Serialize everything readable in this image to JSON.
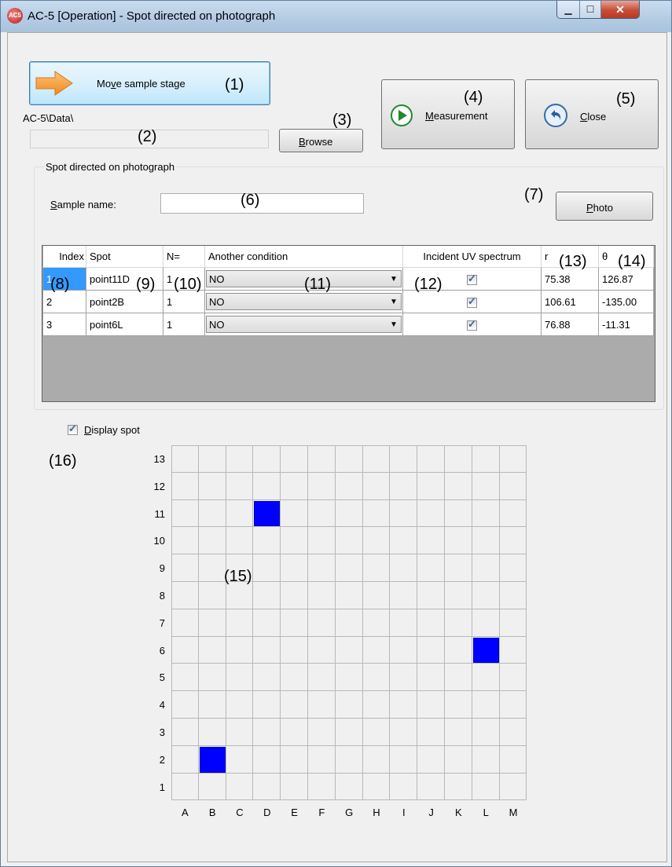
{
  "window": {
    "title": "AC-5 [Operation] - Spot directed on photograph",
    "icon": "ac5-app-icon",
    "icon_text": "AC5",
    "controls": {
      "minimize": "▁",
      "maximize": "☐",
      "close": "✕"
    }
  },
  "toolbar": {
    "move_stage_label_pre": "Mo",
    "move_stage_label_u": "v",
    "move_stage_label_post": "e sample stage",
    "path_label": "AC-5\\Data\\",
    "path_value": "",
    "browse_label_u": "B",
    "browse_label_post": "rowse",
    "measurement_label_u": "M",
    "measurement_label_post": "easurement",
    "close_label_u": "C",
    "close_label_post": "lose"
  },
  "group": {
    "title": "Spot directed on photograph",
    "sample_label_u": "S",
    "sample_label_post": "ample name:",
    "sample_value": "",
    "photo_label_u": "P",
    "photo_label_post": "hoto"
  },
  "table": {
    "columns": [
      "Index",
      "Spot",
      "N=",
      "Another condition",
      "Incident UV spectrum",
      "r",
      "θ"
    ],
    "rows": [
      {
        "index": "1",
        "spot": "point11D",
        "n": "1",
        "condition": "NO",
        "uv": true,
        "r": "75.38",
        "theta": "126.87"
      },
      {
        "index": "2",
        "spot": "point2B",
        "n": "1",
        "condition": "NO",
        "uv": true,
        "r": "106.61",
        "theta": "-135.00"
      },
      {
        "index": "3",
        "spot": "point6L",
        "n": "1",
        "condition": "NO",
        "uv": true,
        "r": "76.88",
        "theta": "-11.31"
      }
    ]
  },
  "display_spot": {
    "checked": true,
    "label_u": "D",
    "label_post": "isplay spot"
  },
  "spot_grid": {
    "columns": [
      "A",
      "B",
      "C",
      "D",
      "E",
      "F",
      "G",
      "H",
      "I",
      "J",
      "K",
      "L",
      "M"
    ],
    "rows": [
      "13",
      "12",
      "11",
      "10",
      "9",
      "8",
      "7",
      "6",
      "5",
      "4",
      "3",
      "2",
      "1"
    ],
    "spots": [
      {
        "col": "D",
        "row": 11
      },
      {
        "col": "B",
        "row": 2
      },
      {
        "col": "L",
        "row": 6
      }
    ],
    "spot_color": "#0000ff"
  },
  "annotations": [
    "(1)",
    "(2)",
    "(3)",
    "(4)",
    "(5)",
    "(6)",
    "(7)",
    "(8)",
    "(9)",
    "(10)",
    "(11)",
    "(12)",
    "(13)",
    "(14)",
    "(15)",
    "(16)"
  ]
}
